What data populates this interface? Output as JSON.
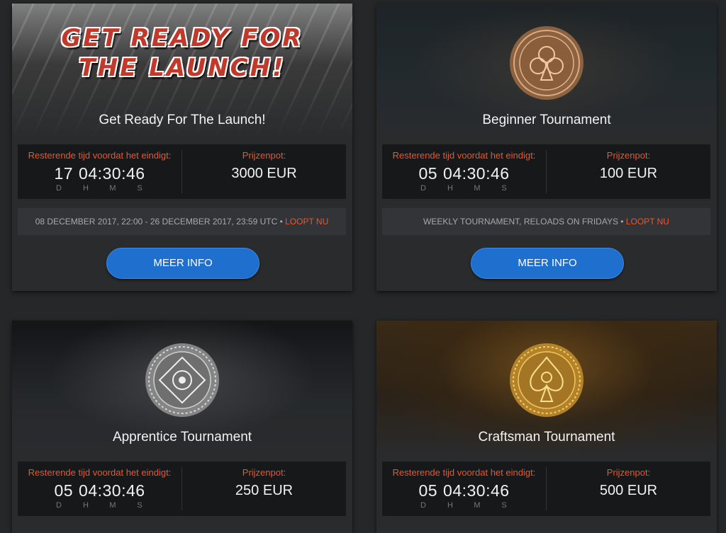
{
  "cards": [
    {
      "title": "Get Ready For The Launch!",
      "headline_line1": "GET READY FOR",
      "headline_line2": "THE LAUNCH!",
      "time_label": "Resterende tijd voordat het eindigt:",
      "days": "17",
      "clock": "04:30:46",
      "prize_label": "Prijzenpot:",
      "prize": "3000 EUR",
      "note": "08 DECEMBER 2017, 22:00 - 26 DECEMBER 2017, 23:59 UTC",
      "status": "LOOPT NU",
      "button": "MEER INFO"
    },
    {
      "title": "Beginner Tournament",
      "emblem_icon": "club-emblem-icon",
      "emblem_color": "#c48a5a",
      "time_label": "Resterende tijd voordat het eindigt:",
      "days": "05",
      "clock": "04:30:46",
      "prize_label": "Prijzenpot:",
      "prize": "100 EUR",
      "note": "WEEKLY TOURNAMENT, RELOADS ON FRIDAYS",
      "status": "LOOPT NU",
      "button": "MEER INFO"
    },
    {
      "title": "Apprentice Tournament",
      "emblem_icon": "diamond-emblem-icon",
      "emblem_color": "#bdbdbd",
      "time_label": "Resterende tijd voordat het eindigt:",
      "days": "05",
      "clock": "04:30:46",
      "prize_label": "Prijzenpot:",
      "prize": "250 EUR"
    },
    {
      "title": "Craftsman Tournament",
      "emblem_icon": "spade-emblem-icon",
      "emblem_color": "#d9a62e",
      "time_label": "Resterende tijd voordat het eindigt:",
      "days": "05",
      "clock": "04:30:46",
      "prize_label": "Prijzenpot:",
      "prize": "500 EUR"
    }
  ],
  "units": {
    "d": "D",
    "h": "H",
    "m": "M",
    "s": "S"
  },
  "colors": {
    "accent_red": "#e8572f",
    "button_blue": "#1f6fce"
  }
}
